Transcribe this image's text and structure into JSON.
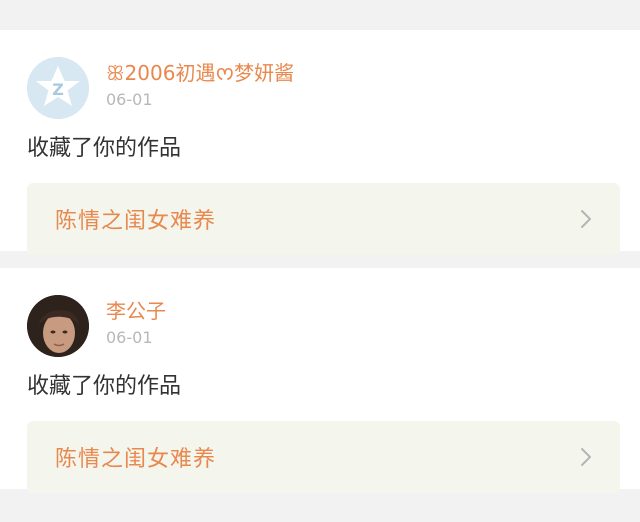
{
  "notifications": [
    {
      "username": "ꕥ2006初遇ᰔ梦妍酱",
      "date": "06-01",
      "action": "收藏了你的作品",
      "work_title": "陈情之闺女难养",
      "avatar_icon": "default-avatar-icon"
    },
    {
      "username": "李公子",
      "date": "06-01",
      "action": "收藏了你的作品",
      "work_title": "陈情之闺女难养",
      "avatar_icon": "user-photo"
    }
  ],
  "colors": {
    "accent": "#e9884d",
    "date": "#b8b8b8",
    "link_bg": "#f4f6ee",
    "page_bg": "#f2f2f2"
  }
}
